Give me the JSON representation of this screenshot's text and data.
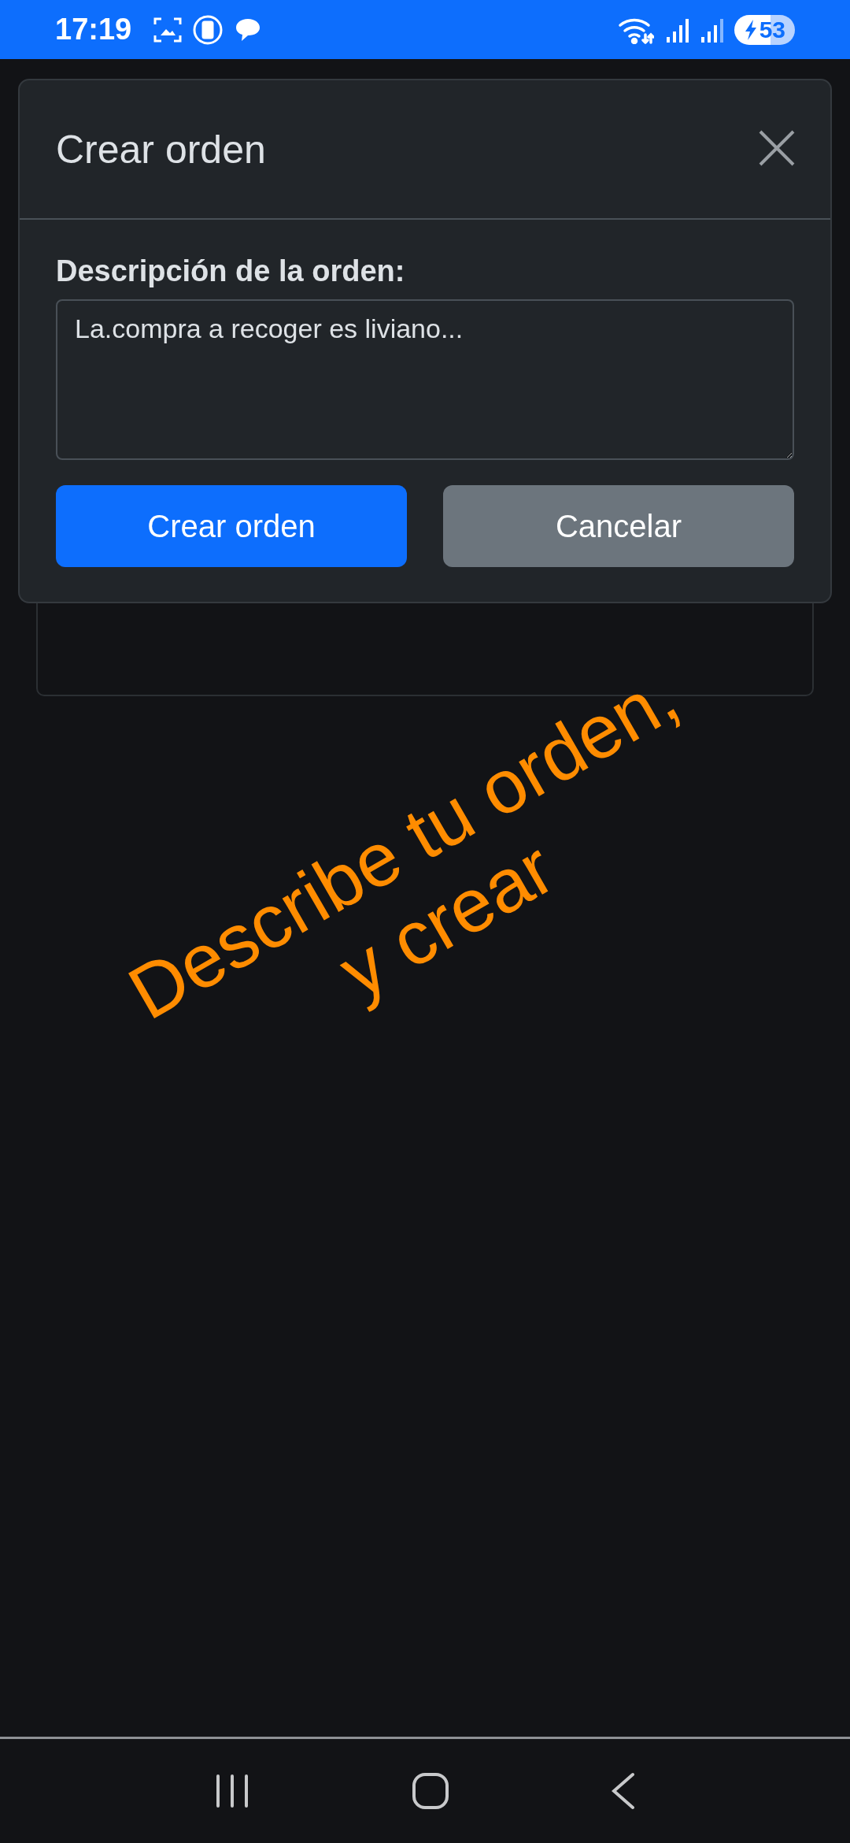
{
  "status_bar": {
    "time": "17:19",
    "battery": "53"
  },
  "modal": {
    "title": "Crear orden",
    "field_label": "Descripción de la orden:",
    "description": {
      "value": "La.compra a recoger es liviano..."
    },
    "buttons": [
      {
        "label": "Crear orden",
        "kind": "primary"
      },
      {
        "label": "Cancelar",
        "kind": "secondary"
      }
    ]
  },
  "annotation": {
    "lines": [
      "Describe tu orden,",
      "y crear"
    ]
  }
}
